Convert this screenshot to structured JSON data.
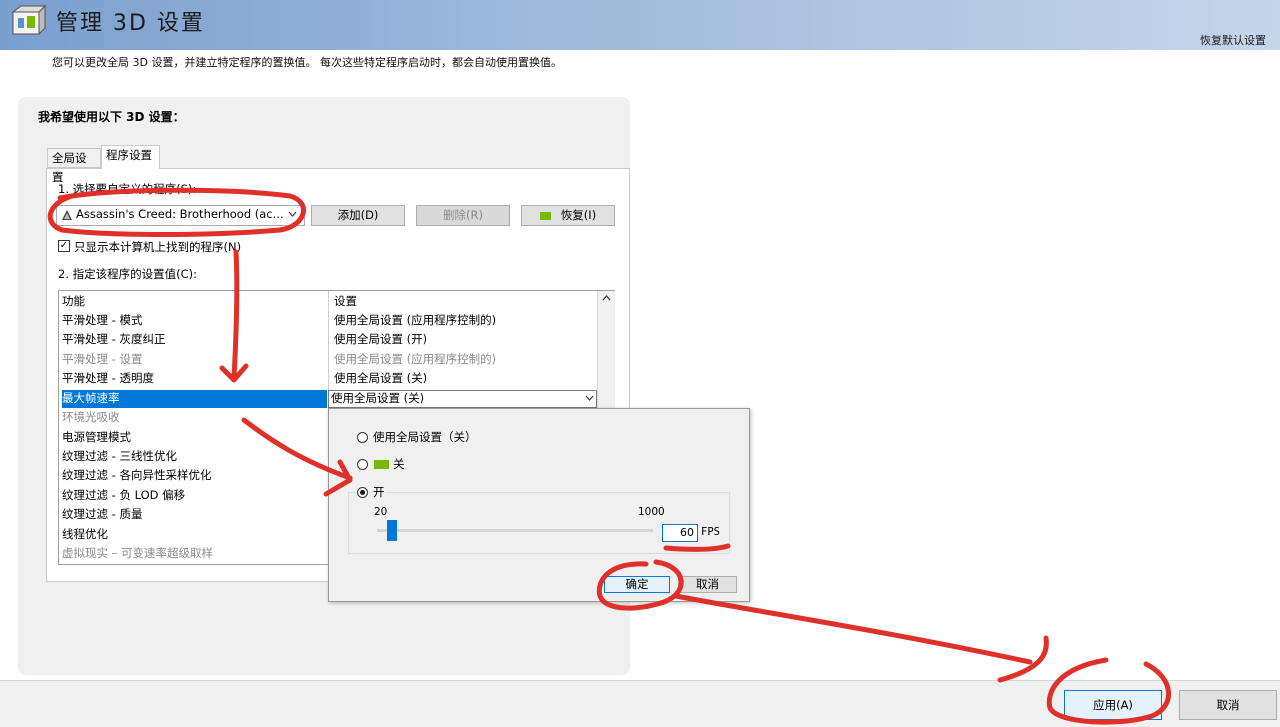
{
  "header": {
    "title": "管理 3D 设置",
    "restore_defaults": "恢复默认设置"
  },
  "description": "您可以更改全局 3D 设置，并建立特定程序的置换值。 每次这些特定程序启动时，都会自动使用置换值。",
  "section_heading": "我希望使用以下 3D 设置：",
  "tabs": [
    {
      "label": "全局设置"
    },
    {
      "label": "程序设置"
    }
  ],
  "program_settings": {
    "step1_label": "1. 选择要自定义的程序(S):",
    "selected_program": "Assassin's Creed: Brotherhood (ac...",
    "add_label": "添加(D)",
    "delete_label": "删除(R)",
    "restore_label": "恢复(I)",
    "only_found_label": "只显示本计算机上找到的程序(N)",
    "step2_label": "2. 指定该程序的设置值(C):"
  },
  "table": {
    "col_feature": "功能",
    "col_setting": "设置",
    "rows": [
      {
        "feature": "平滑处理 - 模式",
        "setting": "使用全局设置 (应用程序控制的)"
      },
      {
        "feature": "平滑处理 - 灰度纠正",
        "setting": "使用全局设置 (开)"
      },
      {
        "feature": "平滑处理 - 设置",
        "setting": "使用全局设置 (应用程序控制的)"
      },
      {
        "feature": "平滑处理 - 透明度",
        "setting": "使用全局设置 (关)"
      },
      {
        "feature": "最大帧速率",
        "setting": "使用全局设置 (关)"
      },
      {
        "feature": "环境光吸收",
        "setting": ""
      },
      {
        "feature": "电源管理模式",
        "setting": ""
      },
      {
        "feature": "纹理过滤 - 三线性优化",
        "setting": ""
      },
      {
        "feature": "纹理过滤 - 各向异性采样优化",
        "setting": ""
      },
      {
        "feature": "纹理过滤 - 负 LOD 偏移",
        "setting": ""
      },
      {
        "feature": "纹理过滤 - 质量",
        "setting": ""
      },
      {
        "feature": "线程优化",
        "setting": ""
      },
      {
        "feature": "虚拟现实 – 可变速率超级取样",
        "setting": ""
      }
    ]
  },
  "popup": {
    "option_global": "使用全局设置（关）",
    "option_off": "关",
    "option_on": "开",
    "slider_min": "20",
    "slider_max": "1000",
    "fps_value": "60",
    "fps_unit": "FPS",
    "ok_label": "确定",
    "cancel_label": "取消"
  },
  "footer": {
    "apply_label": "应用(A)",
    "cancel_label": "取消"
  },
  "colors": {
    "accent": "#0078d7",
    "annotation": "#e0302a",
    "nvidia_green": "#76b900"
  }
}
